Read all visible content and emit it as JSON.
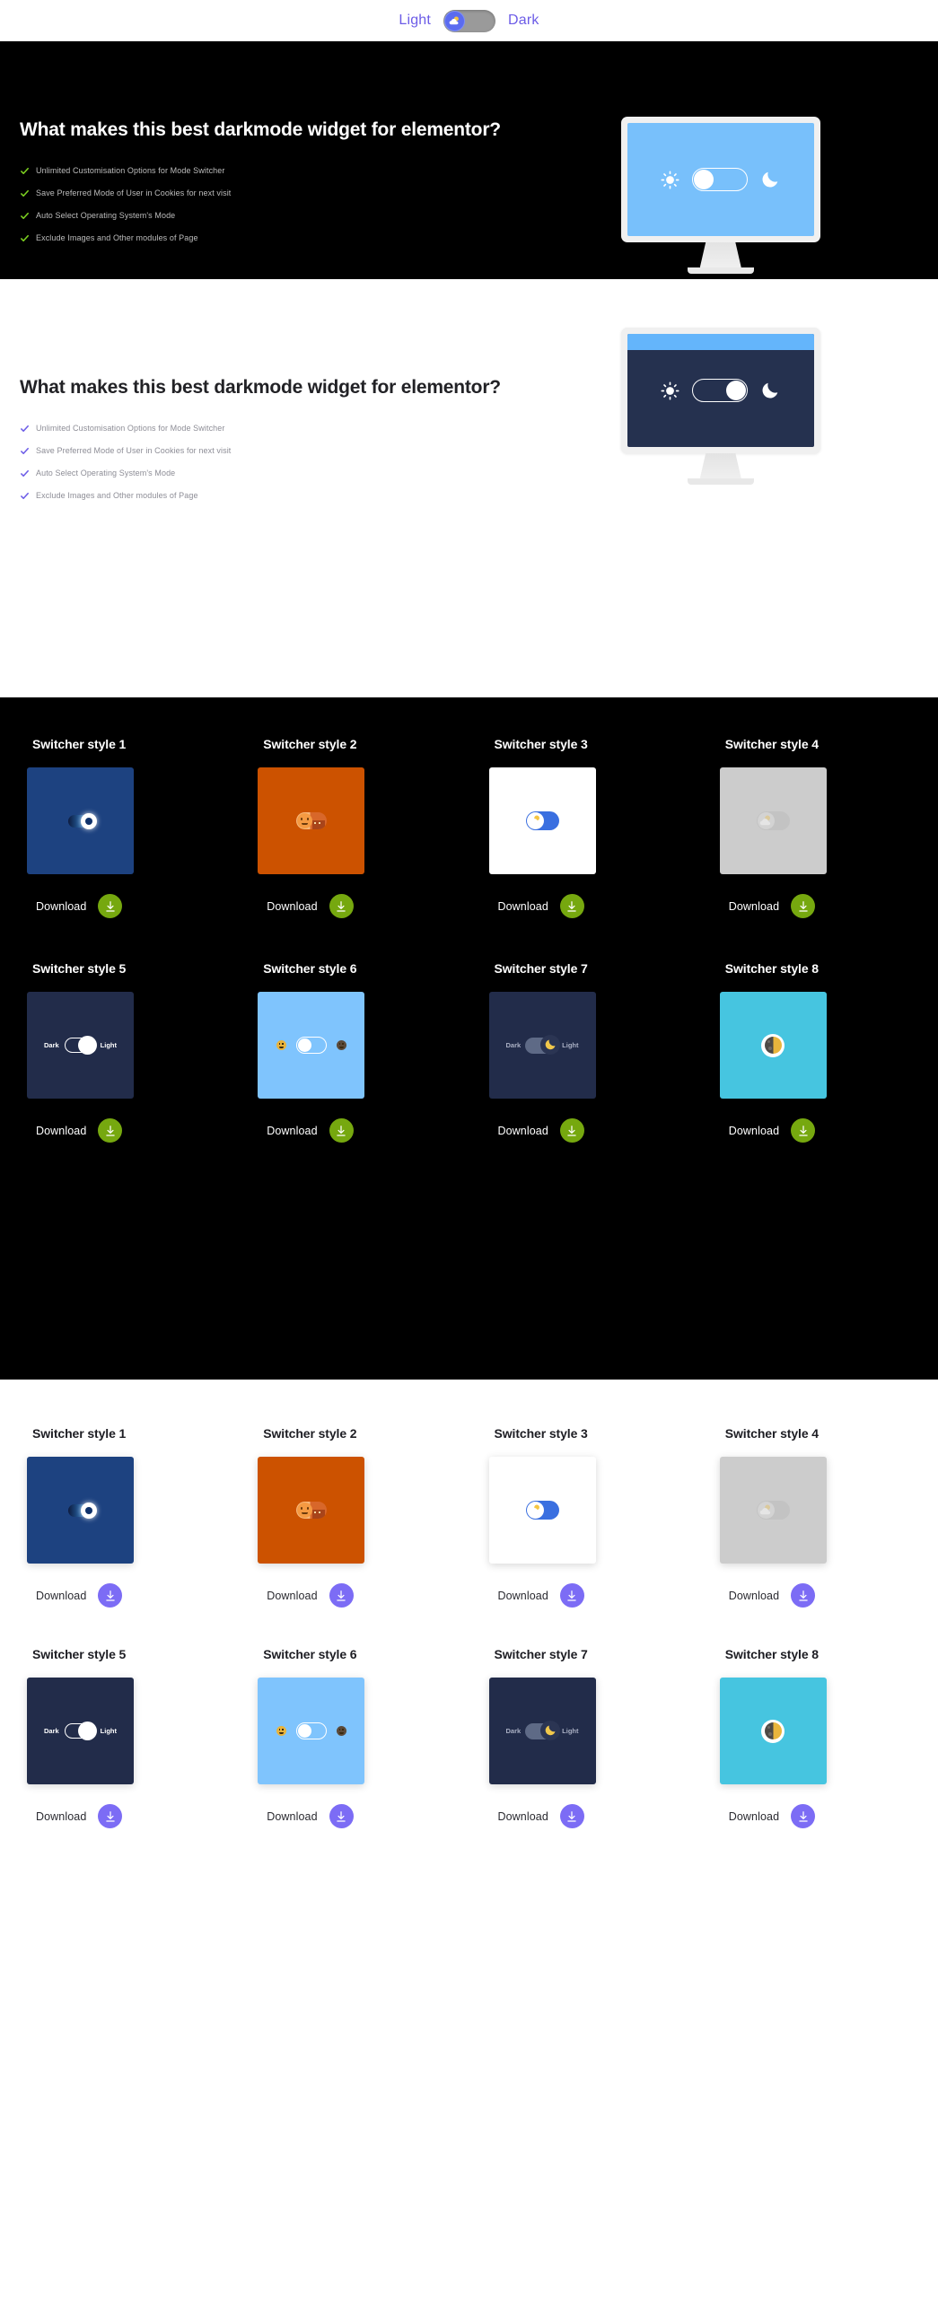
{
  "topbar": {
    "light_label": "Light",
    "dark_label": "Dark",
    "knob_icon": "cloud-sun-icon",
    "track_color": "#9a9a9a",
    "knob_color": "#5b6bf0",
    "label_color": "#6c5ce7",
    "state": "light"
  },
  "hero_dark": {
    "heading": "What makes this best darkmode widget for elementor?",
    "features": [
      "Unlimited Customisation Options for Mode Switcher",
      "Save Preferred Mode of User in Cookies for next visit",
      "Auto Select Operating System's Mode",
      "Exclude Images and Other modules of Page"
    ],
    "check_color": "#7ed321",
    "bg": "#000000",
    "heading_color": "#ffffff",
    "feature_color": "#bdbdbd",
    "monitor": {
      "screen_bg": "#78c0fb",
      "sun_icon": "sun-icon",
      "moon_icon": "moon-icon",
      "toggle_state": "left",
      "has_top_strip": false
    }
  },
  "hero_light": {
    "heading": "What makes this best darkmode widget for elementor?",
    "features": [
      "Unlimited Customisation Options for Mode Switcher",
      "Save Preferred Mode of User in Cookies for next visit",
      "Auto Select Operating System's Mode",
      "Exclude Images and Other modules of Page"
    ],
    "check_color": "#6c5ce7",
    "bg": "#ffffff",
    "heading_color": "#222226",
    "feature_color": "#8d8d96",
    "monitor": {
      "screen_bg": "#25314f",
      "strip_bg": "#64b5fb",
      "sun_icon": "sun-icon",
      "moon_icon": "moon-icon",
      "toggle_state": "right",
      "has_top_strip": true
    }
  },
  "grid_dark": {
    "bg": "#000000",
    "title_color": "#ffffff",
    "download_label": "Download",
    "download_btn_color": "#76a80f",
    "download_icon": "download-arrow-icon",
    "cards": [
      {
        "title": "Switcher style 1",
        "preview_bg": "#1d4280",
        "variant": "s1"
      },
      {
        "title": "Switcher style 2",
        "preview_bg": "#cc5200",
        "variant": "s2"
      },
      {
        "title": "Switcher style 3",
        "preview_bg": "#ffffff",
        "variant": "s3"
      },
      {
        "title": "Switcher style 4",
        "preview_bg": "#cccccc",
        "variant": "s4"
      },
      {
        "title": "Switcher style 5",
        "preview_bg": "#222c4a",
        "variant": "s5",
        "left_label": "Dark",
        "right_label": "Light"
      },
      {
        "title": "Switcher style 6",
        "preview_bg": "#7fc4fd",
        "variant": "s6"
      },
      {
        "title": "Switcher style 7",
        "preview_bg": "#222c4a",
        "variant": "s7",
        "left_label": "Dark",
        "right_label": "Light"
      },
      {
        "title": "Switcher style 8",
        "preview_bg": "#46c5e0",
        "variant": "s8"
      }
    ]
  },
  "grid_light": {
    "bg": "#ffffff",
    "title_color": "#1d1d23",
    "download_label": "Download",
    "download_btn_color": "#7c6cf5",
    "download_icon": "download-arrow-icon",
    "cards": [
      {
        "title": "Switcher style 1",
        "preview_bg": "#1d4280",
        "variant": "s1"
      },
      {
        "title": "Switcher style 2",
        "preview_bg": "#cc5200",
        "variant": "s2"
      },
      {
        "title": "Switcher style 3",
        "preview_bg": "#ffffff",
        "variant": "s3"
      },
      {
        "title": "Switcher style 4",
        "preview_bg": "#cccccc",
        "variant": "s4"
      },
      {
        "title": "Switcher style 5",
        "preview_bg": "#222c4a",
        "variant": "s5",
        "left_label": "Dark",
        "right_label": "Light"
      },
      {
        "title": "Switcher style 6",
        "preview_bg": "#7fc4fd",
        "variant": "s6"
      },
      {
        "title": "Switcher style 7",
        "preview_bg": "#222c4a",
        "variant": "s7",
        "left_label": "Dark",
        "right_label": "Light"
      },
      {
        "title": "Switcher style 8",
        "preview_bg": "#46c5e0",
        "variant": "s8"
      }
    ]
  }
}
